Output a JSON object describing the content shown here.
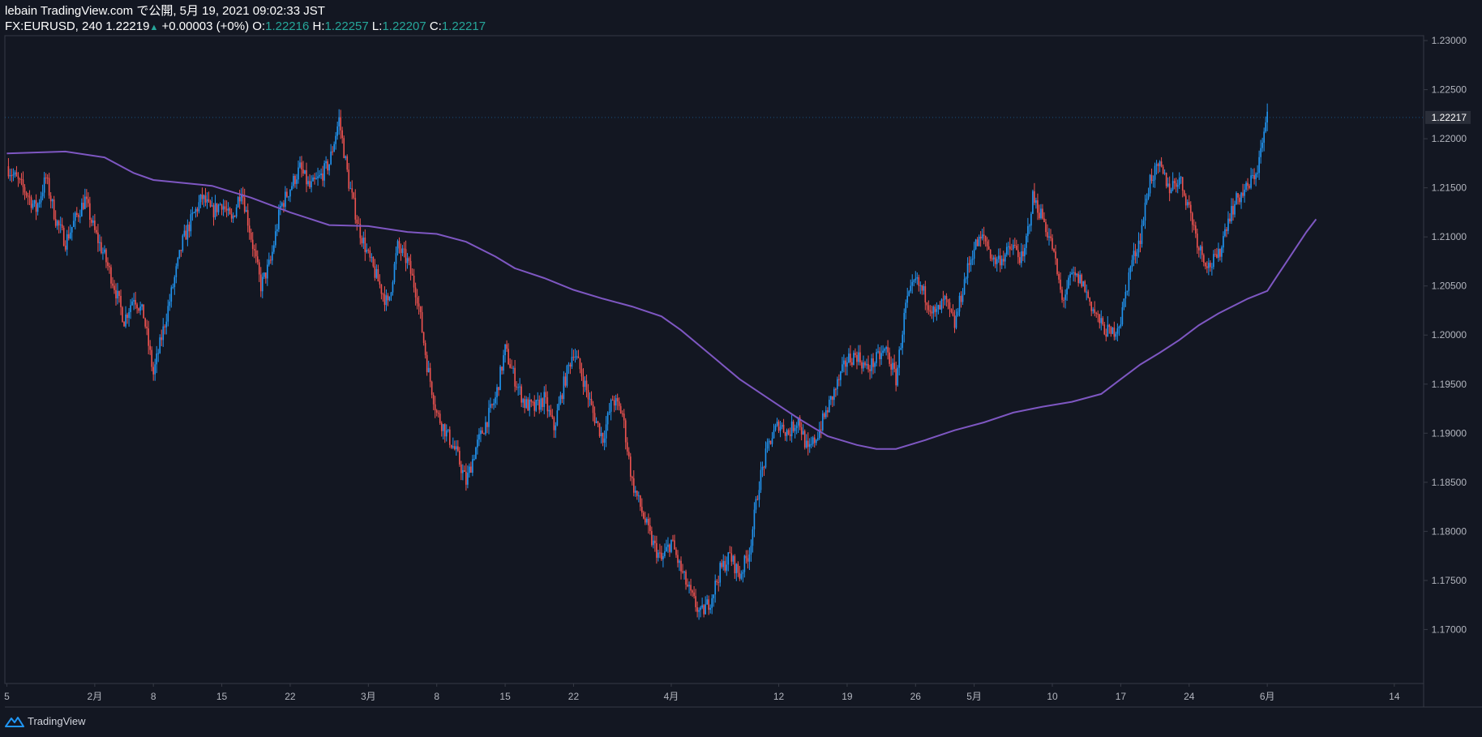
{
  "header": {
    "publish_line": "lebain TradingView.com で公開, 5月 19, 2021 09:02:33 JST",
    "symbol": "FX:EURUSD, 240",
    "last": "1.22219",
    "change": "+0.00003 (+0%)",
    "o_label": "O:",
    "o_value": "1.22216",
    "h_label": "H:",
    "h_value": "1.22257",
    "l_label": "L:",
    "l_value": "1.22207",
    "c_label": "C:",
    "c_value": "1.22217"
  },
  "brand": {
    "name": "TradingView"
  },
  "colors": {
    "background": "#131722",
    "up": "#2196f3",
    "down": "#ef5350",
    "ma": "#7e57c2",
    "axis_text": "#b2b5be",
    "border": "#363a45"
  },
  "chart_data": {
    "type": "candlestick",
    "symbol": "FX:EURUSD",
    "interval": "240",
    "y_axis": {
      "ticks": [
        "1.23000",
        "1.22500",
        "1.22000",
        "1.21500",
        "1.21000",
        "1.20500",
        "1.20000",
        "1.19500",
        "1.19000",
        "1.18500",
        "1.18000",
        "1.17500",
        "1.17000"
      ],
      "ylim": [
        1.1645,
        1.2305
      ],
      "last_price_label": "1.22217"
    },
    "x_axis": {
      "ticks": [
        {
          "label": "5",
          "d": -1
        },
        {
          "label": "2月",
          "d": 8
        },
        {
          "label": "8",
          "d": 14
        },
        {
          "label": "15",
          "d": 21
        },
        {
          "label": "22",
          "d": 28
        },
        {
          "label": "3月",
          "d": 36
        },
        {
          "label": "8",
          "d": 43
        },
        {
          "label": "15",
          "d": 50
        },
        {
          "label": "22",
          "d": 57
        },
        {
          "label": "4月",
          "d": 67
        },
        {
          "label": "12",
          "d": 78
        },
        {
          "label": "19",
          "d": 85
        },
        {
          "label": "26",
          "d": 92
        },
        {
          "label": "5月",
          "d": 98
        },
        {
          "label": "10",
          "d": 106
        },
        {
          "label": "17",
          "d": 113
        },
        {
          "label": "24",
          "d": 120
        },
        {
          "label": "6月",
          "d": 128
        },
        {
          "label": "14",
          "d": 141
        }
      ],
      "day_zero": "2021-01-25",
      "xlim": [
        -1.2,
        144
      ]
    },
    "close_series": [
      [
        -1,
        1.2172
      ],
      [
        1,
        1.2145
      ],
      [
        2,
        1.2128
      ],
      [
        3,
        1.216
      ],
      [
        4,
        1.2118
      ],
      [
        5,
        1.2095
      ],
      [
        6,
        1.2118
      ],
      [
        7,
        1.2138
      ],
      [
        8,
        1.2105
      ],
      [
        9,
        1.208
      ],
      [
        10,
        1.205
      ],
      [
        11,
        1.2015
      ],
      [
        12,
        1.204
      ],
      [
        13,
        1.202
      ],
      [
        14,
        1.196
      ],
      [
        15,
        1.2005
      ],
      [
        16,
        1.205
      ],
      [
        17,
        1.2095
      ],
      [
        18,
        1.212
      ],
      [
        19,
        1.214
      ],
      [
        20,
        1.2125
      ],
      [
        21,
        1.2135
      ],
      [
        22,
        1.2115
      ],
      [
        23,
        1.215
      ],
      [
        24,
        1.21
      ],
      [
        25,
        1.205
      ],
      [
        26,
        1.2075
      ],
      [
        27,
        1.213
      ],
      [
        28,
        1.215
      ],
      [
        29,
        1.217
      ],
      [
        30,
        1.215
      ],
      [
        31,
        1.216
      ],
      [
        32,
        1.2175
      ],
      [
        33,
        1.222
      ],
      [
        34,
        1.2155
      ],
      [
        35,
        1.211
      ],
      [
        36,
        1.208
      ],
      [
        37,
        1.2055
      ],
      [
        38,
        1.203
      ],
      [
        39,
        1.209
      ],
      [
        40,
        1.2075
      ],
      [
        41,
        1.204
      ],
      [
        42,
        1.197
      ],
      [
        43,
        1.192
      ],
      [
        44,
        1.19
      ],
      [
        45,
        1.188
      ],
      [
        46,
        1.185
      ],
      [
        47,
        1.1885
      ],
      [
        48,
        1.191
      ],
      [
        49,
        1.1935
      ],
      [
        50,
        1.1985
      ],
      [
        51,
        1.1955
      ],
      [
        52,
        1.193
      ],
      [
        53,
        1.1925
      ],
      [
        54,
        1.1935
      ],
      [
        55,
        1.1905
      ],
      [
        56,
        1.195
      ],
      [
        57,
        1.1985
      ],
      [
        58,
        1.1955
      ],
      [
        59,
        1.192
      ],
      [
        60,
        1.1895
      ],
      [
        61,
        1.1935
      ],
      [
        62,
        1.192
      ],
      [
        63,
        1.185
      ],
      [
        64,
        1.182
      ],
      [
        65,
        1.179
      ],
      [
        66,
        1.177
      ],
      [
        67,
        1.179
      ],
      [
        68,
        1.176
      ],
      [
        69,
        1.1735
      ],
      [
        70,
        1.1715
      ],
      [
        71,
        1.173
      ],
      [
        72,
        1.176
      ],
      [
        73,
        1.1775
      ],
      [
        74,
        1.1755
      ],
      [
        75,
        1.178
      ],
      [
        76,
        1.185
      ],
      [
        77,
        1.189
      ],
      [
        78,
        1.191
      ],
      [
        79,
        1.19
      ],
      [
        80,
        1.1915
      ],
      [
        81,
        1.188
      ],
      [
        82,
        1.19
      ],
      [
        83,
        1.1925
      ],
      [
        84,
        1.195
      ],
      [
        85,
        1.1975
      ],
      [
        86,
        1.198
      ],
      [
        87,
        1.1965
      ],
      [
        88,
        1.1975
      ],
      [
        89,
        1.1985
      ],
      [
        90,
        1.1955
      ],
      [
        91,
        1.203
      ],
      [
        92,
        1.2055
      ],
      [
        93,
        1.204
      ],
      [
        94,
        1.202
      ],
      [
        95,
        1.2035
      ],
      [
        96,
        1.201
      ],
      [
        97,
        1.2055
      ],
      [
        98,
        1.209
      ],
      [
        99,
        1.21
      ],
      [
        100,
        1.2075
      ],
      [
        101,
        1.208
      ],
      [
        102,
        1.209
      ],
      [
        103,
        1.2075
      ],
      [
        104,
        1.214
      ],
      [
        105,
        1.212
      ],
      [
        106,
        1.209
      ],
      [
        107,
        1.2035
      ],
      [
        108,
        1.206
      ],
      [
        109,
        1.2055
      ],
      [
        110,
        1.203
      ],
      [
        111,
        1.201
      ],
      [
        112,
        1.2
      ],
      [
        113,
        1.2015
      ],
      [
        114,
        1.207
      ],
      [
        115,
        1.21
      ],
      [
        116,
        1.216
      ],
      [
        117,
        1.217
      ],
      [
        118,
        1.215
      ],
      [
        119,
        1.216
      ],
      [
        120,
        1.213
      ],
      [
        121,
        1.209
      ],
      [
        122,
        1.207
      ],
      [
        123,
        1.208
      ],
      [
        124,
        1.212
      ],
      [
        125,
        1.214
      ],
      [
        126,
        1.215
      ],
      [
        127,
        1.217
      ],
      [
        128,
        1.2222
      ]
    ],
    "ma_series": [
      [
        -1,
        1.2185
      ],
      [
        5,
        1.2187
      ],
      [
        9,
        1.2181
      ],
      [
        12,
        1.2165
      ],
      [
        14,
        1.2158
      ],
      [
        20,
        1.2152
      ],
      [
        24,
        1.214
      ],
      [
        28,
        1.2125
      ],
      [
        32,
        1.2112
      ],
      [
        36,
        1.2111
      ],
      [
        40,
        1.2105
      ],
      [
        43,
        1.2103
      ],
      [
        46,
        1.2095
      ],
      [
        49,
        1.208
      ],
      [
        51,
        1.2068
      ],
      [
        54,
        1.2058
      ],
      [
        57,
        1.2046
      ],
      [
        60,
        1.2037
      ],
      [
        63,
        1.2029
      ],
      [
        66,
        1.2019
      ],
      [
        68,
        1.2005
      ],
      [
        71,
        1.198
      ],
      [
        74,
        1.1955
      ],
      [
        77,
        1.1935
      ],
      [
        80,
        1.1915
      ],
      [
        83,
        1.1897
      ],
      [
        86,
        1.1888
      ],
      [
        88,
        1.1884
      ],
      [
        90,
        1.1884
      ],
      [
        93,
        1.1893
      ],
      [
        96,
        1.1903
      ],
      [
        99,
        1.1911
      ],
      [
        102,
        1.1921
      ],
      [
        105,
        1.1927
      ],
      [
        108,
        1.1932
      ],
      [
        111,
        1.194
      ],
      [
        113,
        1.1955
      ],
      [
        115,
        1.197
      ],
      [
        117,
        1.1982
      ],
      [
        119,
        1.1995
      ],
      [
        121,
        1.201
      ],
      [
        123,
        1.2022
      ],
      [
        124,
        1.2027
      ],
      [
        126,
        1.2037
      ],
      [
        128,
        1.2045
      ],
      [
        129,
        1.206
      ],
      [
        130,
        1.2075
      ],
      [
        131,
        1.209
      ],
      [
        132,
        1.2105
      ],
      [
        133,
        1.2118
      ]
    ]
  }
}
